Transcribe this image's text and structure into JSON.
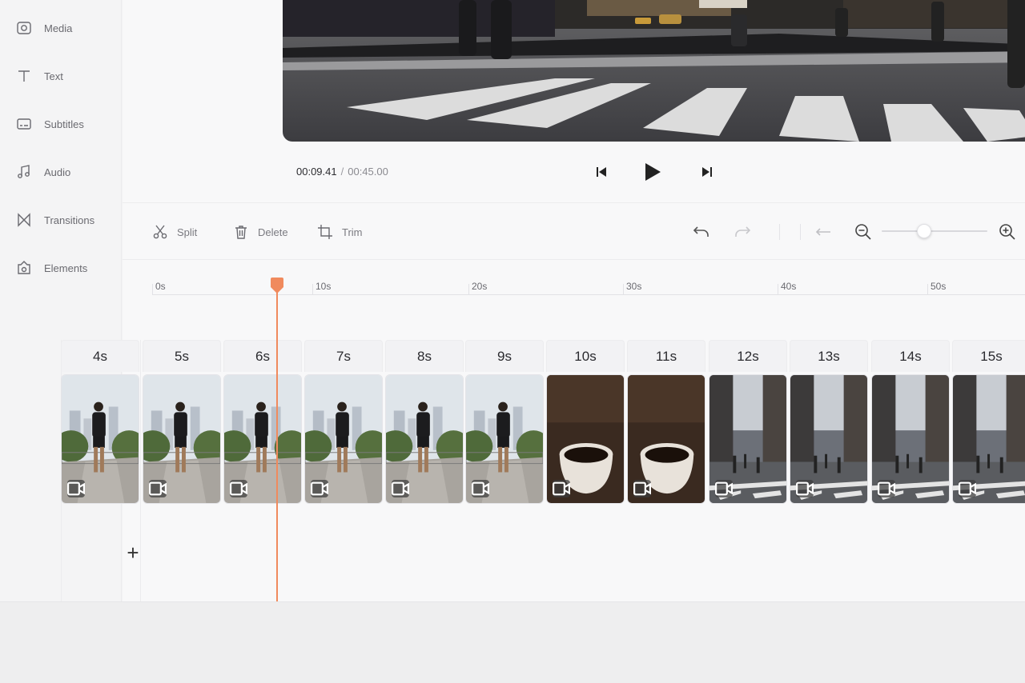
{
  "sidebar": {
    "items": [
      {
        "label": "Media",
        "icon": "media-icon"
      },
      {
        "label": "Text",
        "icon": "text-icon"
      },
      {
        "label": "Subtitles",
        "icon": "subtitles-icon"
      },
      {
        "label": "Audio",
        "icon": "audio-icon"
      },
      {
        "label": "Transitions",
        "icon": "transitions-icon"
      },
      {
        "label": "Elements",
        "icon": "elements-icon"
      }
    ]
  },
  "player": {
    "current_time": "00:09.41",
    "separator": "/",
    "total_time": "00:45.00"
  },
  "toolbar": {
    "split_label": "Split",
    "delete_label": "Delete",
    "trim_label": "Trim"
  },
  "ruler": {
    "ticks": [
      "0s",
      "10s",
      "20s",
      "30s",
      "40s",
      "50s"
    ]
  },
  "zoom": {
    "level": 0.4
  },
  "clips": [
    {
      "duration": "4s",
      "scene": "runner"
    },
    {
      "duration": "5s",
      "scene": "runner"
    },
    {
      "duration": "6s",
      "scene": "runner"
    },
    {
      "duration": "7s",
      "scene": "runner"
    },
    {
      "duration": "8s",
      "scene": "runner"
    },
    {
      "duration": "9s",
      "scene": "runner"
    },
    {
      "duration": "10s",
      "scene": "coffee"
    },
    {
      "duration": "11s",
      "scene": "coffee"
    },
    {
      "duration": "12s",
      "scene": "street"
    },
    {
      "duration": "13s",
      "scene": "street"
    },
    {
      "duration": "14s",
      "scene": "street"
    },
    {
      "duration": "15s",
      "scene": "street"
    }
  ],
  "colors": {
    "accent": "#f08a5d",
    "text": "#333333",
    "muted": "#7a7a80"
  }
}
